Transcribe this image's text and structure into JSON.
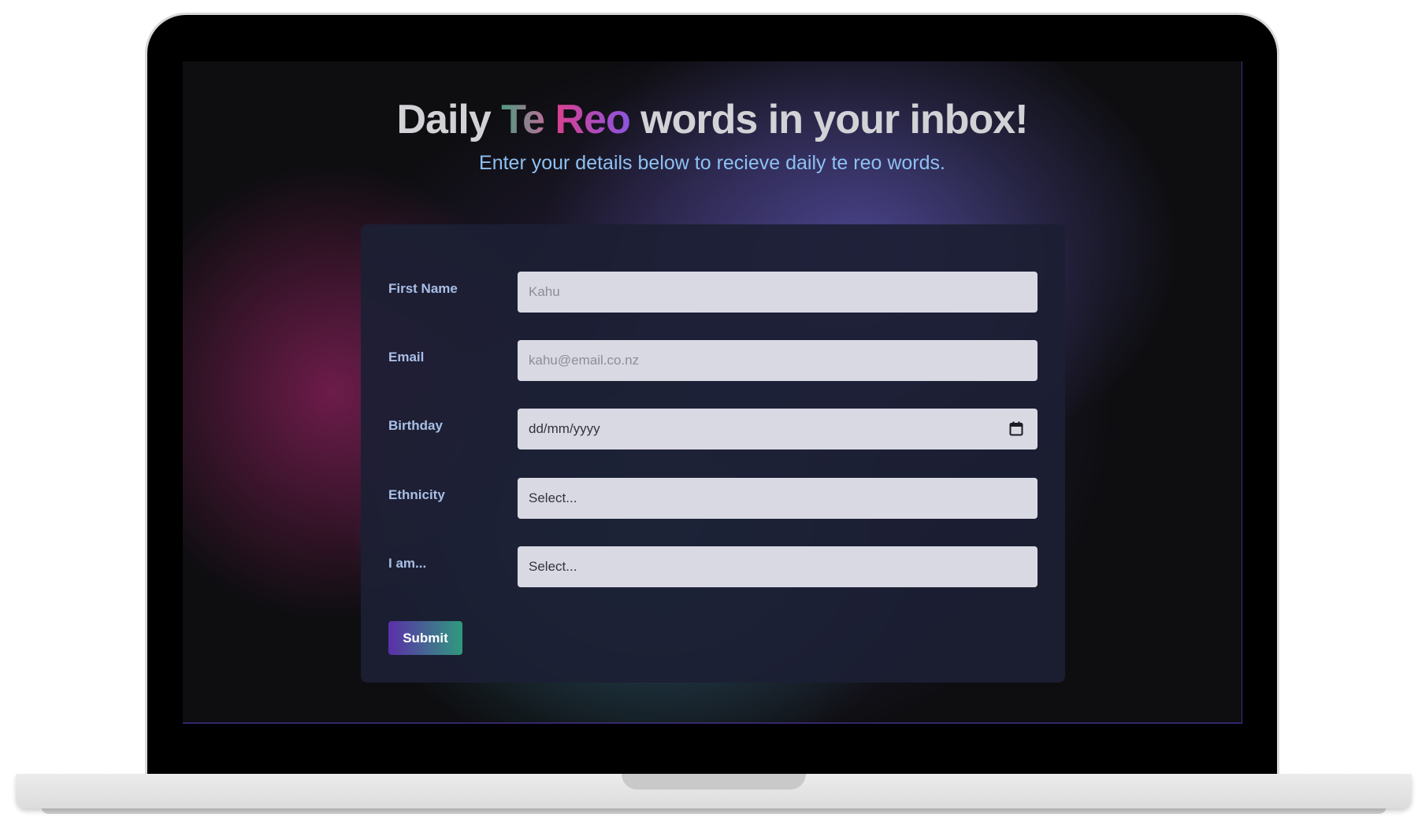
{
  "hero": {
    "title_start": "Daily ",
    "title_te": "Te",
    "title_space": " ",
    "title_reo": "Reo",
    "title_end": " words in your inbox!",
    "subtitle": "Enter your details below to recieve daily te reo words."
  },
  "form": {
    "first_name": {
      "label": "First Name",
      "placeholder": "Kahu"
    },
    "email": {
      "label": "Email",
      "placeholder": "kahu@email.co.nz"
    },
    "birthday": {
      "label": "Birthday",
      "value": "dd/mm/yyyy",
      "icon": "calendar-icon"
    },
    "ethnicity": {
      "label": "Ethnicity",
      "value": "Select..."
    },
    "role": {
      "label": "I am...",
      "value": "Select..."
    },
    "submit_label": "Submit"
  },
  "colors": {
    "title": "#d2d2d6",
    "subtitle": "#8ec0f2",
    "label": "#a9bfe6",
    "field_bg": "#d9d9e4",
    "button_start": "#5b2fa8",
    "button_end": "#2f9a7e"
  }
}
